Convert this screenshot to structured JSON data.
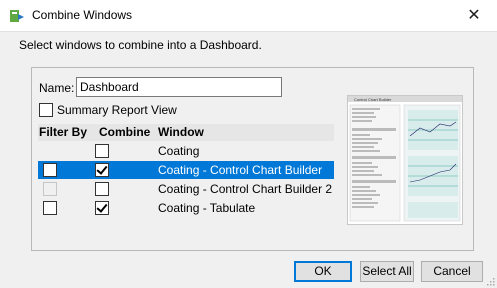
{
  "window": {
    "title": "Combine Windows",
    "icon": "combine-windows-app-icon",
    "close_glyph": "✕"
  },
  "instruction": "Select windows to combine into a Dashboard.",
  "name_field": {
    "label": "Name:",
    "value": "Dashboard"
  },
  "summary_report": {
    "label": "Summary Report View",
    "checked": false
  },
  "table": {
    "headers": {
      "filter_by": "Filter By",
      "combine": "Combine",
      "window": "Window"
    },
    "rows": [
      {
        "window": "Coating",
        "filter_by": null,
        "combine": false,
        "selected": false
      },
      {
        "window": "Coating - Control Chart Builder",
        "filter_by": false,
        "combine": true,
        "selected": true
      },
      {
        "window": "Coating - Control Chart Builder 2",
        "filter_by": "disabled",
        "combine": false,
        "selected": false
      },
      {
        "window": "Coating - Tabulate",
        "filter_by": false,
        "combine": true,
        "selected": false
      }
    ]
  },
  "preview": {
    "thumbnail_of": "Coating - Control Chart Builder",
    "title": "Control Chart Builder"
  },
  "buttons": {
    "ok": "OK",
    "select_all": "Select All",
    "cancel": "Cancel"
  },
  "colors": {
    "selection": "#0078d7",
    "selection_text": "#ffffff",
    "dialog_bg": "#f0f0f0"
  }
}
